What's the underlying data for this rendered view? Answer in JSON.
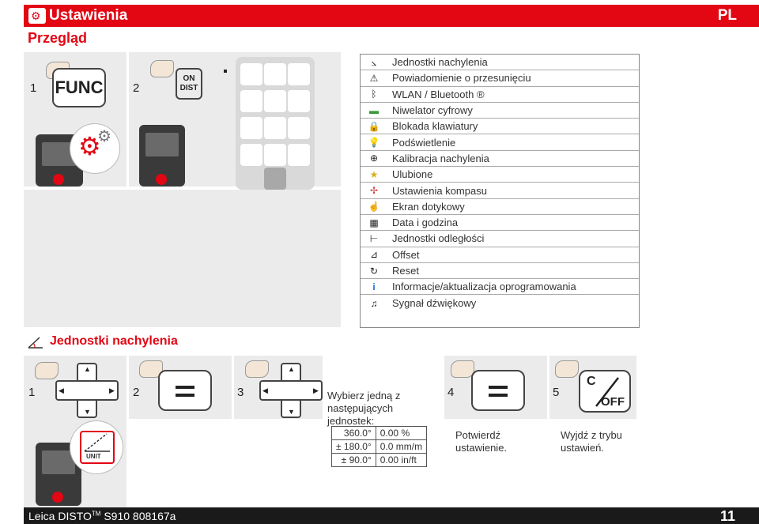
{
  "header": {
    "title": "Ustawienia",
    "lang": "PL"
  },
  "subtitle": "Przegląd",
  "overview": {
    "step1": {
      "num": "1",
      "key": "FUNC"
    },
    "step2": {
      "num": "2",
      "key_line1": "ON",
      "key_line2": "DIST"
    }
  },
  "menu": {
    "items": [
      {
        "icon": "tilt-unit-icon",
        "glyph": "⦣",
        "label": "Jednostki nachylenia"
      },
      {
        "icon": "offset-alert-icon",
        "glyph": "⚠",
        "label": "Powiadomienie o przesunięciu"
      },
      {
        "icon": "wlan-bluetooth-icon",
        "glyph": "ᛒ",
        "label": "WLAN / Bluetooth ®"
      },
      {
        "icon": "level-icon",
        "glyph": "▬",
        "label": "Niwelator cyfrowy"
      },
      {
        "icon": "lock-icon",
        "glyph": "🔒",
        "label": "Blokada klawiatury"
      },
      {
        "icon": "bulb-icon",
        "glyph": "💡",
        "label": "Podświetlenie"
      },
      {
        "icon": "tilt-calibration-icon",
        "glyph": "⊕",
        "label": "Kalibracja nachylenia"
      },
      {
        "icon": "star-icon",
        "glyph": "★",
        "label": "Ulubione"
      },
      {
        "icon": "compass-icon",
        "glyph": "✢",
        "label": "Ustawienia kompasu"
      },
      {
        "icon": "touch-icon",
        "glyph": "☝",
        "label": "Ekran dotykowy"
      },
      {
        "icon": "calendar-icon",
        "glyph": "▦",
        "label": "Data i godzina"
      },
      {
        "icon": "ruler-icon",
        "glyph": "⊢",
        "label": "Jednostki odległości"
      },
      {
        "icon": "offset-icon",
        "glyph": "⊿",
        "label": "Offset"
      },
      {
        "icon": "reset-icon",
        "glyph": "↻",
        "label": "Reset"
      },
      {
        "icon": "info-icon",
        "glyph": "i",
        "label": "Informacje/aktualizacja oprogramowania"
      },
      {
        "icon": "music-icon",
        "glyph": "♫",
        "label": "Sygnał dźwiękowy"
      }
    ]
  },
  "section": {
    "title": "Jednostki nachylenia"
  },
  "steps": {
    "s1": "1",
    "s2": "2",
    "s3": "3",
    "s4": "4",
    "s5": "5",
    "s3_text": "Wybierz jedną z następujących jednostek:",
    "s4_text": "Potwierdź ustawienie.",
    "s5_text": "Wyjdź z trybu ustawień.",
    "off_c": "C",
    "off_label": "OFF",
    "unit_label": "UNIT"
  },
  "units_table": [
    [
      "360.0°",
      "0.00 %"
    ],
    [
      "± 180.0°",
      "0.0 mm/m"
    ],
    [
      "± 90.0°",
      "0.00 in/ft"
    ]
  ],
  "footer": {
    "product": "Leica DISTO",
    "tm": "TM",
    "model": "S910 808167a",
    "page": "11"
  },
  "colors": {
    "accent": "#e30613",
    "panel": "#ebebeb",
    "footer": "#1a1a1a"
  }
}
